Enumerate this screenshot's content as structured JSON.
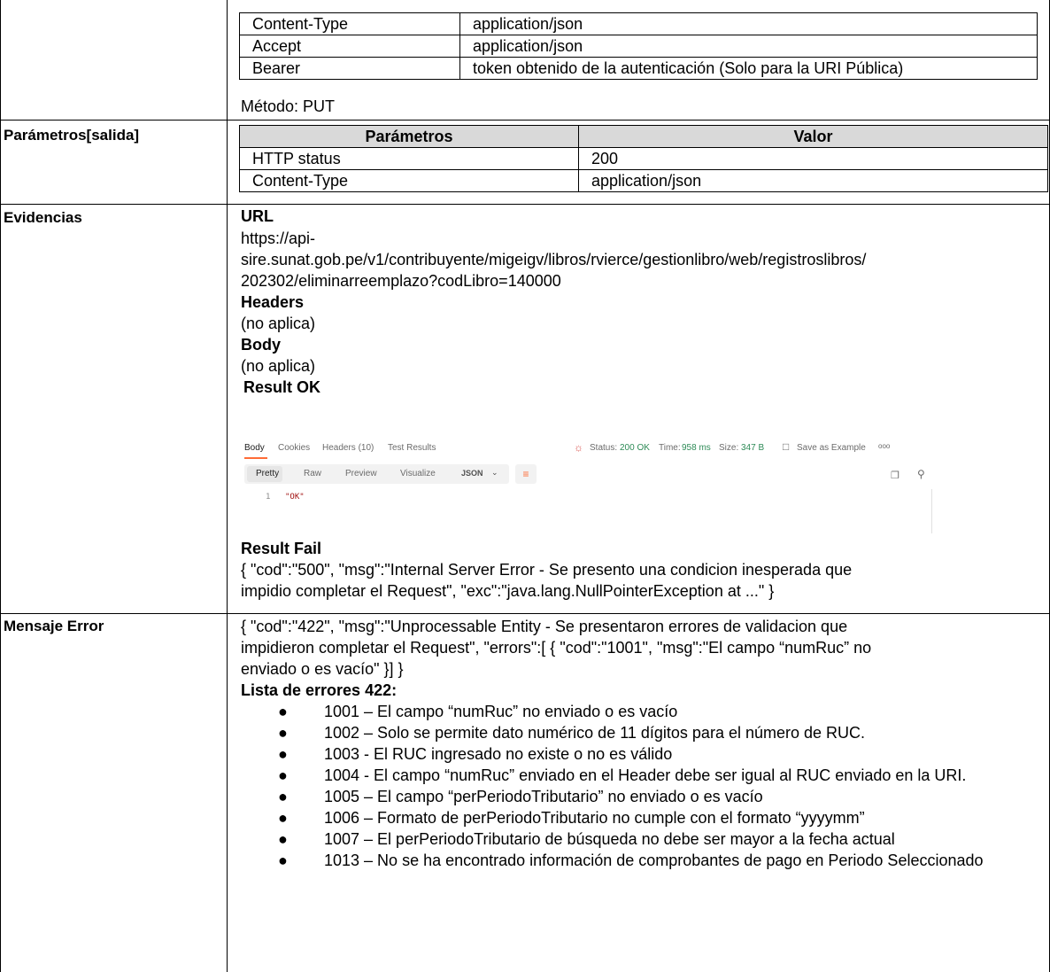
{
  "header_table": {
    "rows": [
      {
        "key": "Content-Type",
        "value": "application/json"
      },
      {
        "key": "Accept",
        "value": "application/json"
      },
      {
        "key": "Bearer",
        "value": "token obtenido de la autenticación (Solo para la URI Pública)"
      }
    ]
  },
  "method_line": "Método:  PUT",
  "params_out": {
    "label": "Parámetros[salida]",
    "headers": [
      "Parámetros",
      "Valor"
    ],
    "rows": [
      {
        "key": "HTTP status",
        "value": "200"
      },
      {
        "key": "Content-Type",
        "value": "application/json"
      }
    ]
  },
  "evidencias": {
    "label": "Evidencias",
    "url_title": "URL",
    "url_lines": [
      "https://api-",
      "sire.sunat.gob.pe/v1/contribuyente/migeigv/libros/rvierce/gestionlibro/web/registroslibros/",
      "202302/eliminarreemplazo?codLibro=140000"
    ],
    "headers_title": "Headers",
    "headers_value": "(no aplica)",
    "body_title": "Body",
    "body_value": "(no aplica)",
    "result_ok_title": "Result OK",
    "result_fail_title": "Result Fail",
    "result_fail_lines": [
      "{ \"cod\":\"500\", \"msg\":\"Internal Server Error - Se presento una condicion inesperada que",
      "impidio completar el Request\", \"exc\":\"java.lang.NullPointerException at ...\" }"
    ]
  },
  "postman": {
    "tabs": [
      "Body",
      "Cookies",
      "Headers (10)",
      "Test Results"
    ],
    "status_label": "Status:",
    "status_value": "200 OK",
    "time_label": "Time:",
    "time_value": "958 ms",
    "size_label": "Size:",
    "size_value": "347 B",
    "save_example": "Save as Example",
    "more": "ooo",
    "views": [
      "Pretty",
      "Raw",
      "Preview",
      "Visualize"
    ],
    "format": "JSON",
    "line_no": "1",
    "code": "\"OK\"",
    "colors": {
      "accent": "#ff6c37",
      "status": "#2e8b57"
    }
  },
  "mensaje_error": {
    "label": "Mensaje Error",
    "lines": [
      "{ \"cod\":\"422\", \"msg\":\"Unprocessable Entity - Se presentaron errores de validacion que",
      "impidieron completar el Request\", \"errors\":[ { \"cod\":\"1001\", \"msg\":\"El campo “numRuc” no",
      "enviado o es vacío\" }] }"
    ],
    "list_title": "Lista de errores 422:",
    "errors": [
      "1001 – El campo “numRuc” no enviado o es vacío",
      "1002 – Solo se permite dato numérico de 11 dígitos para el número de RUC.",
      "1003 - El RUC ingresado no existe o no es válido",
      "1004 - El campo “numRuc” enviado en el Header debe ser igual al RUC enviado en la URI.",
      "1005 – El campo “perPeriodoTributario” no enviado o es vacío",
      "1006 – Formato de perPeriodoTributario no cumple con el formato “yyyymm”",
      "1007 – El perPeriodoTributario de búsqueda no debe ser mayor a la fecha actual",
      "1013 – No se ha encontrado información de comprobantes de pago en Periodo Seleccionado"
    ],
    "bullet": "●"
  }
}
